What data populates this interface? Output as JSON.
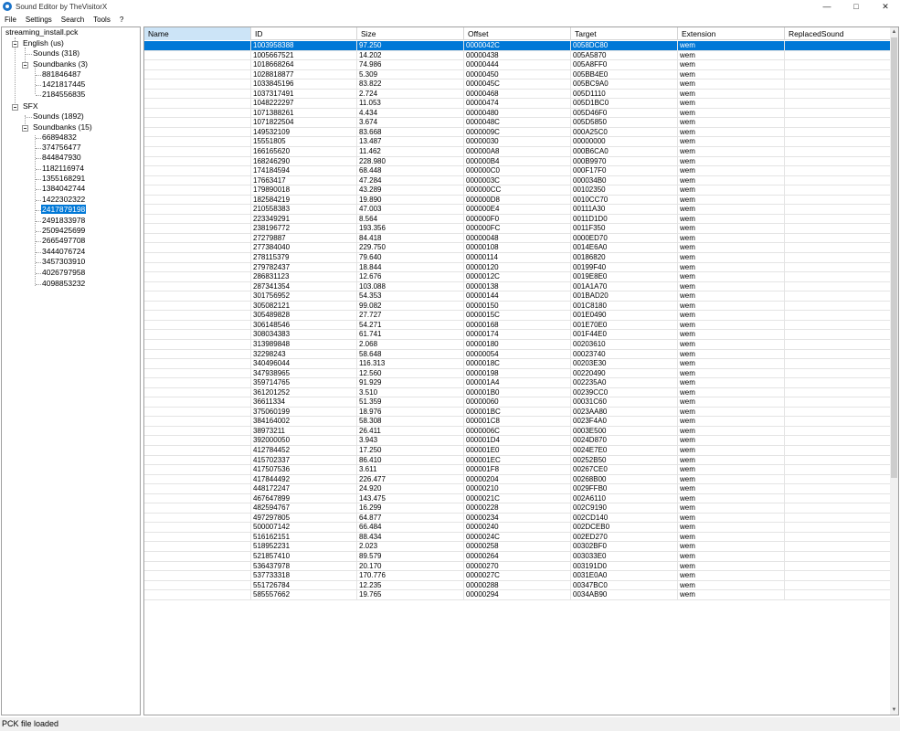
{
  "window": {
    "title": "Sound Editor by TheVisitorX"
  },
  "menu": [
    "File",
    "Settings",
    "Search",
    "Tools",
    "?"
  ],
  "tree": {
    "root": "streaming_install.pck",
    "english": "English (us)",
    "english_sounds": "Sounds (318)",
    "english_soundbanks": "Soundbanks (3)",
    "english_banks": [
      "881846487",
      "1421817445",
      "2184556835"
    ],
    "sfx": "SFX",
    "sfx_sounds": "Sounds (1892)",
    "sfx_soundbanks": "Soundbanks (15)",
    "sfx_banks": [
      "66894832",
      "374756477",
      "844847930",
      "1182116974",
      "1355168291",
      "1384042744",
      "1422302322",
      "2417879198",
      "2491833978",
      "2509425699",
      "2665497708",
      "3444076724",
      "3457303910",
      "4026797958",
      "4098853232"
    ],
    "selected_bank": "2417879198"
  },
  "grid": {
    "columns": [
      "Name",
      "ID",
      "Size",
      "Offset",
      "Target",
      "Extension",
      "ReplacedSound"
    ],
    "rows": [
      [
        "",
        "1003958388",
        "97.250",
        "0000042C",
        "0058DC80",
        "wem",
        ""
      ],
      [
        "",
        "1005667521",
        "14.202",
        "00000438",
        "005A5870",
        "wem",
        ""
      ],
      [
        "",
        "1018668264",
        "74.986",
        "00000444",
        "005A8FF0",
        "wem",
        ""
      ],
      [
        "",
        "1028818877",
        "5.309",
        "00000450",
        "005BB4E0",
        "wem",
        ""
      ],
      [
        "",
        "1033845196",
        "83.822",
        "0000045C",
        "005BC9A0",
        "wem",
        ""
      ],
      [
        "",
        "1037317491",
        "2.724",
        "00000468",
        "005D1110",
        "wem",
        ""
      ],
      [
        "",
        "1048222297",
        "11.053",
        "00000474",
        "005D1BC0",
        "wem",
        ""
      ],
      [
        "",
        "1071388261",
        "4.434",
        "00000480",
        "005D46F0",
        "wem",
        ""
      ],
      [
        "",
        "1071822504",
        "3.674",
        "0000048C",
        "005D5850",
        "wem",
        ""
      ],
      [
        "",
        "149532109",
        "83.668",
        "0000009C",
        "000A25C0",
        "wem",
        ""
      ],
      [
        "",
        "15551805",
        "13.487",
        "00000030",
        "00000000",
        "wem",
        ""
      ],
      [
        "",
        "166165620",
        "11.462",
        "000000A8",
        "000B6CA0",
        "wem",
        ""
      ],
      [
        "",
        "168246290",
        "228.980",
        "000000B4",
        "000B9970",
        "wem",
        ""
      ],
      [
        "",
        "174184594",
        "68.448",
        "000000C0",
        "000F17F0",
        "wem",
        ""
      ],
      [
        "",
        "17663417",
        "47.284",
        "0000003C",
        "000034B0",
        "wem",
        ""
      ],
      [
        "",
        "179890018",
        "43.289",
        "000000CC",
        "00102350",
        "wem",
        ""
      ],
      [
        "",
        "182584219",
        "19.890",
        "000000D8",
        "0010CC70",
        "wem",
        ""
      ],
      [
        "",
        "210558383",
        "47.003",
        "000000E4",
        "00111A30",
        "wem",
        ""
      ],
      [
        "",
        "223349291",
        "8.564",
        "000000F0",
        "0011D1D0",
        "wem",
        ""
      ],
      [
        "",
        "238196772",
        "193.356",
        "000000FC",
        "0011F350",
        "wem",
        ""
      ],
      [
        "",
        "27279887",
        "84.418",
        "00000048",
        "0000ED70",
        "wem",
        ""
      ],
      [
        "",
        "277384040",
        "229.750",
        "00000108",
        "0014E6A0",
        "wem",
        ""
      ],
      [
        "",
        "278115379",
        "79.640",
        "00000114",
        "00186820",
        "wem",
        ""
      ],
      [
        "",
        "279782437",
        "18.844",
        "00000120",
        "00199F40",
        "wem",
        ""
      ],
      [
        "",
        "286831123",
        "12.676",
        "0000012C",
        "0019E8E0",
        "wem",
        ""
      ],
      [
        "",
        "287341354",
        "103.088",
        "00000138",
        "001A1A70",
        "wem",
        ""
      ],
      [
        "",
        "301756952",
        "54.353",
        "00000144",
        "001BAD20",
        "wem",
        ""
      ],
      [
        "",
        "305082121",
        "99.082",
        "00000150",
        "001C8180",
        "wem",
        ""
      ],
      [
        "",
        "305489828",
        "27.727",
        "0000015C",
        "001E0490",
        "wem",
        ""
      ],
      [
        "",
        "306148546",
        "54.271",
        "00000168",
        "001E70E0",
        "wem",
        ""
      ],
      [
        "",
        "308034383",
        "61.741",
        "00000174",
        "001F44E0",
        "wem",
        ""
      ],
      [
        "",
        "313989848",
        "2.068",
        "00000180",
        "00203610",
        "wem",
        ""
      ],
      [
        "",
        "32298243",
        "58.648",
        "00000054",
        "00023740",
        "wem",
        ""
      ],
      [
        "",
        "340496044",
        "116.313",
        "0000018C",
        "00203E30",
        "wem",
        ""
      ],
      [
        "",
        "347938965",
        "12.560",
        "00000198",
        "00220490",
        "wem",
        ""
      ],
      [
        "",
        "359714765",
        "91.929",
        "000001A4",
        "002235A0",
        "wem",
        ""
      ],
      [
        "",
        "361201252",
        "3.510",
        "000001B0",
        "00239CC0",
        "wem",
        ""
      ],
      [
        "",
        "36611334",
        "51.359",
        "00000060",
        "00031C60",
        "wem",
        ""
      ],
      [
        "",
        "375060199",
        "18.976",
        "000001BC",
        "0023AA80",
        "wem",
        ""
      ],
      [
        "",
        "384164002",
        "58.308",
        "000001C8",
        "0023F4A0",
        "wem",
        ""
      ],
      [
        "",
        "38973211",
        "26.411",
        "0000006C",
        "0003E500",
        "wem",
        ""
      ],
      [
        "",
        "392000050",
        "3.943",
        "000001D4",
        "0024D870",
        "wem",
        ""
      ],
      [
        "",
        "412784452",
        "17.250",
        "000001E0",
        "0024E7E0",
        "wem",
        ""
      ],
      [
        "",
        "415702337",
        "86.410",
        "000001EC",
        "00252B50",
        "wem",
        ""
      ],
      [
        "",
        "417507536",
        "3.611",
        "000001F8",
        "00267CE0",
        "wem",
        ""
      ],
      [
        "",
        "417844492",
        "226.477",
        "00000204",
        "00268B00",
        "wem",
        ""
      ],
      [
        "",
        "448172247",
        "24.920",
        "00000210",
        "0029FFB0",
        "wem",
        ""
      ],
      [
        "",
        "467647899",
        "143.475",
        "0000021C",
        "002A6110",
        "wem",
        ""
      ],
      [
        "",
        "482594767",
        "16.299",
        "00000228",
        "002C9190",
        "wem",
        ""
      ],
      [
        "",
        "497297805",
        "64.877",
        "00000234",
        "002CD140",
        "wem",
        ""
      ],
      [
        "",
        "500007142",
        "66.484",
        "00000240",
        "002DCEB0",
        "wem",
        ""
      ],
      [
        "",
        "516162151",
        "88.434",
        "0000024C",
        "002ED270",
        "wem",
        ""
      ],
      [
        "",
        "518952231",
        "2.023",
        "00000258",
        "00302BF0",
        "wem",
        ""
      ],
      [
        "",
        "521857410",
        "89.579",
        "00000264",
        "003033E0",
        "wem",
        ""
      ],
      [
        "",
        "536437978",
        "20.170",
        "00000270",
        "003191D0",
        "wem",
        ""
      ],
      [
        "",
        "537733318",
        "170.776",
        "0000027C",
        "0031E0A0",
        "wem",
        ""
      ],
      [
        "",
        "551726784",
        "12.235",
        "00000288",
        "00347BC0",
        "wem",
        ""
      ],
      [
        "",
        "585557662",
        "19.765",
        "00000294",
        "0034AB90",
        "wem",
        ""
      ]
    ]
  },
  "status": {
    "text": "PCK file loaded"
  }
}
